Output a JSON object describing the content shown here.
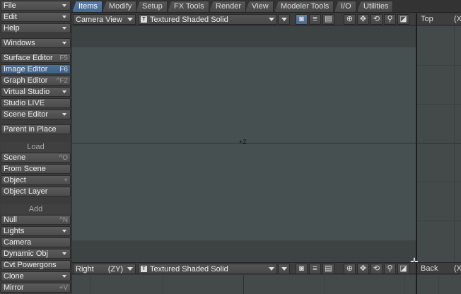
{
  "sidebar": {
    "top_menus": [
      {
        "label": "File"
      },
      {
        "label": "Edit"
      },
      {
        "label": "Help"
      }
    ],
    "windows": {
      "label": "Windows"
    },
    "editors": [
      {
        "label": "Surface Editor",
        "shortcut": "F5"
      },
      {
        "label": "Image Editor",
        "shortcut": "F6"
      },
      {
        "label": "Graph Editor",
        "shortcut": "^F2"
      },
      {
        "label": "Virtual Studio",
        "shortcut": ""
      },
      {
        "label": "Studio LIVE",
        "shortcut": ""
      },
      {
        "label": "Scene Editor",
        "shortcut": ""
      }
    ],
    "parent_in_place": "Parent in Place",
    "load_header": "Load",
    "load_items": [
      {
        "label": "Scene",
        "shortcut": "^O"
      },
      {
        "label": "From Scene",
        "shortcut": ""
      },
      {
        "label": "Object",
        "shortcut": "+"
      },
      {
        "label": "Object Layer",
        "shortcut": ""
      }
    ],
    "add_header": "Add",
    "add_items": [
      {
        "label": "Null",
        "shortcut": "^N"
      },
      {
        "label": "Lights",
        "shortcut": ""
      },
      {
        "label": "Camera",
        "shortcut": ""
      },
      {
        "label": "Dynamic Obj",
        "shortcut": ""
      },
      {
        "label": "Cvt Powergons",
        "shortcut": ""
      },
      {
        "label": "Clone",
        "shortcut": ""
      },
      {
        "label": "Mirror",
        "shortcut": "+V"
      }
    ]
  },
  "tabs": [
    "Items",
    "Modify",
    "Setup",
    "FX Tools",
    "Render",
    "View",
    "Modeler Tools",
    "I/O",
    "Utilities"
  ],
  "viewport_main": {
    "view": "Camera View",
    "shading": "Textured Shaded Solid",
    "axis_label": "+Z"
  },
  "viewport_top": {
    "view": "Top",
    "extra": "(X"
  },
  "viewport_right": {
    "view": "Right",
    "axes": "(ZY)",
    "shading": "Textured Shaded Solid"
  },
  "viewport_back": {
    "view": "Back",
    "extra": "(X"
  },
  "colors": {
    "active_tab": "#5a7faa",
    "viewport_bg": "#444a4a",
    "camera_area": "#465050"
  }
}
